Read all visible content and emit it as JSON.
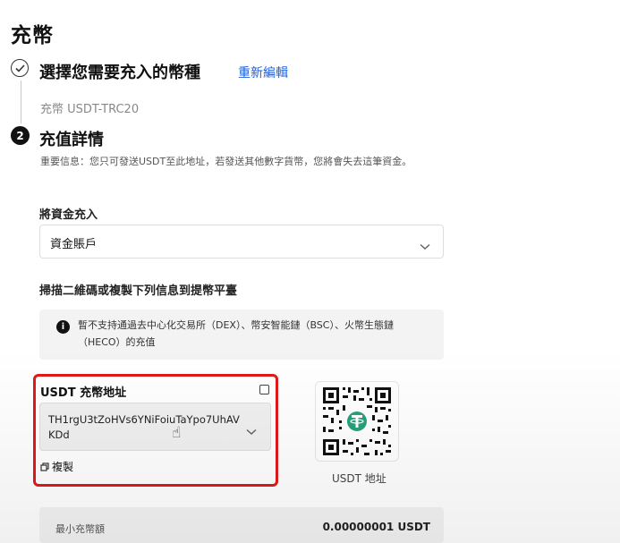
{
  "page": {
    "title": "充幣"
  },
  "step1": {
    "title": "選擇您需要充入的幣種",
    "edit_label": "重新編輯",
    "selected_coin": "充幣 USDT-TRC20"
  },
  "step2": {
    "number": "2",
    "title": "充值詳情",
    "important_notice": "重要信息：您只可發送USDT至此地址，若發送其他數字貨幣，您將會失去這筆資金。",
    "fund_label": "將資金充入",
    "fund_account": "資金賬戶",
    "scan_label": "掃描二維碼或複製下列信息到提幣平臺",
    "warning_text": "暫不支持通過去中心化交易所（DEX）、幣安智能鏈（BSC）、火幣生態鏈（HECO）的充值",
    "address_label": "USDT 充幣地址",
    "address": "TH1rgU3tZoHVs6YNiFoiuTaYpo7UhAVKDd",
    "copy_label": "複製",
    "qr_caption": "USDT 地址",
    "min_deposit_label": "最小充幣額",
    "min_deposit_value": "0.00000001 USDT"
  },
  "colors": {
    "accent_link": "#1e5fd8",
    "highlight_frame": "#e0191a",
    "tether_green": "#26a17b"
  },
  "icons": [
    "check-icon",
    "chevron-down-icon",
    "info-icon",
    "qr-code-icon",
    "copy-icon",
    "hand-cursor-icon",
    "tether-logo"
  ]
}
